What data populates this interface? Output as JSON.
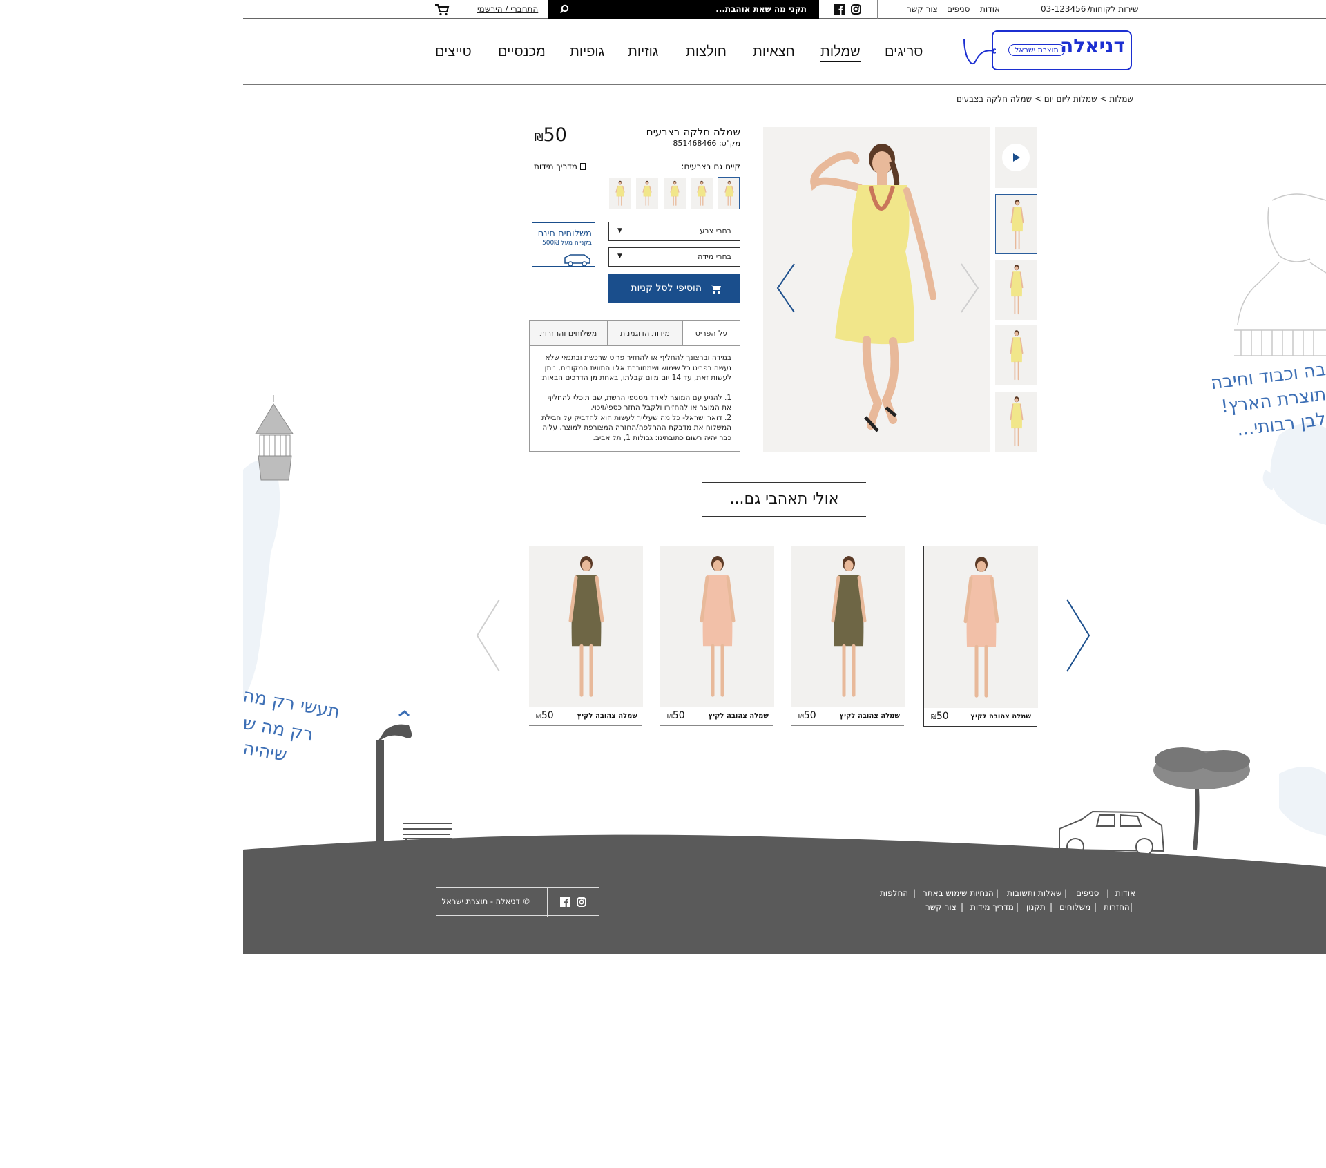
{
  "topbar": {
    "service_label": "שירות לקוחות",
    "service_phone": "03-1234567",
    "links": [
      "אודות",
      "סניפים",
      "צור קשר"
    ],
    "search_placeholder": "תקני מה שאת אוהבת...",
    "login_label": "התחברי / הירשמי"
  },
  "logo": {
    "name": "דניאלה",
    "tagline": "תוצרת ישראל"
  },
  "nav": {
    "items": [
      "סריגים",
      "שמלות",
      "חצאיות",
      "חולצות",
      "גוזיות",
      "גופיות",
      "מכנסיים",
      "טייצים"
    ],
    "active": "שמלות"
  },
  "breadcrumb": "שמלות > שמלות ליום יום > שמלה חלקה בצבעים",
  "product": {
    "title": "שמלה חלקה בצבעים",
    "sku": "מק\"ט: 851468466",
    "price": "50",
    "currency": "₪",
    "colors_label": "קיים גם בצבעים:",
    "size_guide": "מדריך מידות",
    "color_select": "בחרי צבע",
    "size_select": "בחרי מידה",
    "add_to_cart": "הוסיפי לסל קניות",
    "free_shipping": "משלוחים חינם",
    "free_shipping_sub": "בקנייה מעל 500₪",
    "dress_color": "#f1e68a"
  },
  "tabs": {
    "items": [
      "על הפריט",
      "מידות הדוגמנית",
      "משלוחים והחזרות"
    ],
    "body_p1": "במידה וברצונך להחליף או להחזיר פריט שרכשת ובתנאי שלא נעשה בפריט כל שימוש ושמחוברת אליו התווית המקורית, ניתן לעשות זאת, עד 14 יום מיום קבלתו, באחת מן הדרכים הבאות:",
    "body_p2": "1. להגיע עם המוצר לאחד מסניפי הרשת, שם תוכלי להחליף את המוצר או להחזירו ולקבל החזר כספי/זיכוי.",
    "body_p3": "2. דואר ישראל- כל מה שעלייך לעשות הוא להדביק על חבילת המשלוח את מדבקת ההחלפה/החזרה המצורפת למוצר, עליה כבר יהיה רשום כתובתינו: גבולות 1, תל אביב."
  },
  "recommendations": {
    "title": "אולי תאהבי גם...",
    "items": [
      {
        "name": "שמלה צהובה לקיץ",
        "price": "50",
        "color": "#f2c0a8"
      },
      {
        "name": "שמלה צהובה לקיץ",
        "price": "50",
        "color": "#6e6645"
      },
      {
        "name": "שמלה צהובה לקיץ",
        "price": "50",
        "color": "#f2c0a8"
      },
      {
        "name": "שמלה צהובה לקיץ",
        "price": "50",
        "color": "#6e6645"
      }
    ]
  },
  "slogans": {
    "right": [
      "בה וכבוד וחיבה",
      "תוצרת הארץ!",
      "לבן רבותי..."
    ],
    "left": [
      "תעשי רק מה",
      "רק מה ש",
      "שיהיה"
    ]
  },
  "footer": {
    "row1": [
      "אודות",
      "סניפים",
      "שאלות ותשובות",
      "הנחיות שימוש באתר",
      "החלפות"
    ],
    "row2": [
      "החזרות",
      "משלוחים",
      "תקנון",
      "מדריך מידות",
      "צור קשר"
    ],
    "copyright": "© דניאלה - תוצרת ישראל"
  },
  "colors": {
    "brand_blue": "#1a4e8c",
    "logo_blue": "#1c2fd1",
    "footer_gray": "#5a5a5a"
  }
}
